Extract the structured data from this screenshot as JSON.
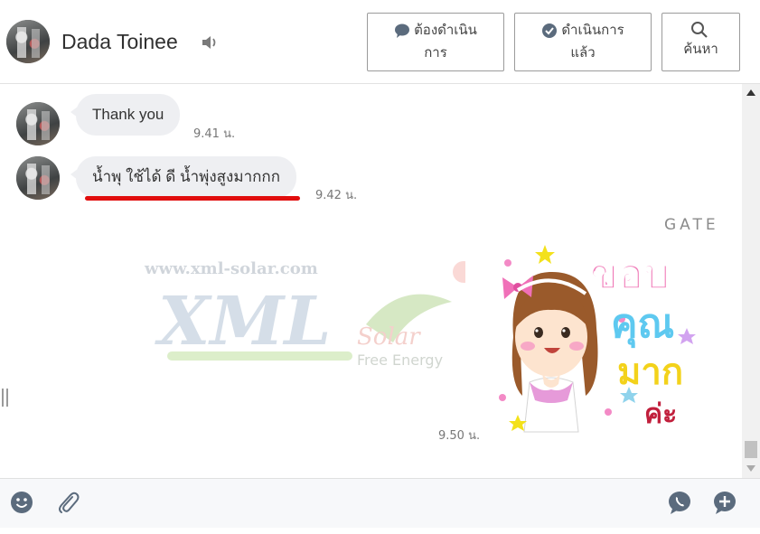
{
  "header": {
    "contact_name": "Dada Toinee",
    "buttons": {
      "todo_line1": "ต้องดำเนิน",
      "todo_line2": "การ",
      "done_line1": "ดำเนินการ",
      "done_line2": "แล้ว",
      "search": "ค้นหา"
    }
  },
  "messages": [
    {
      "text": "Thank you",
      "time": "9.41 น."
    },
    {
      "text": "น้ำพุ ใช้ได้ ดี น้ำพุ่งสูงมากกก",
      "time": "9.42 น."
    }
  ],
  "sticker": {
    "label": "GATE",
    "time": "9.50 น.",
    "text_lines": [
      "ขอบ",
      "คุณ",
      "มาก",
      "ค่ะ"
    ]
  },
  "watermark": {
    "url": "www.xml-solar.com",
    "logo_main": "XML",
    "logo_sub": "Solar",
    "tagline": "Free Energy"
  },
  "colors": {
    "underline": "#e10d0d",
    "bubble": "#eeeff2",
    "icons": "#5b6b7d"
  },
  "icons": [
    "speaker-icon",
    "chat-bubble-icon",
    "check-circle-icon",
    "search-icon",
    "emoji-icon",
    "paperclip-icon",
    "phone-bubble-icon",
    "plus-bubble-icon"
  ]
}
